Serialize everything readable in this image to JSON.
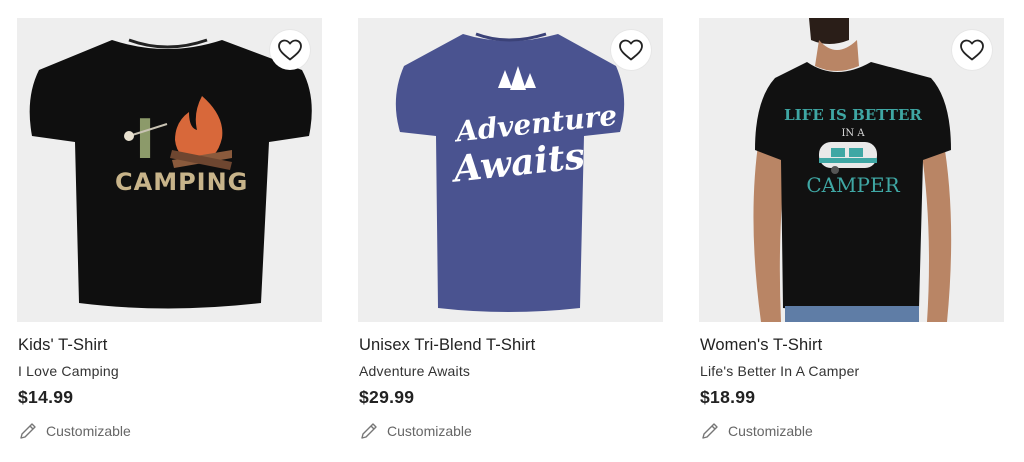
{
  "products": [
    {
      "title": "Kids' T-Shirt",
      "design": "I Love Camping",
      "price": "$14.99",
      "customizable_label": "Customizable",
      "shirt_color": "#0f0f0f",
      "print_text": [
        "I",
        "CAMPING"
      ]
    },
    {
      "title": "Unisex Tri-Blend T-Shirt",
      "design": "Adventure Awaits",
      "price": "$29.99",
      "customizable_label": "Customizable",
      "shirt_color": "#4a5390",
      "print_text": [
        "Adventure",
        "Awaits"
      ]
    },
    {
      "title": "Women's T-Shirt",
      "design": "Life's Better In A Camper",
      "price": "$18.99",
      "customizable_label": "Customizable",
      "shirt_color": "#111111",
      "print_text": [
        "LIFE IS BETTER",
        "IN A",
        "CAMPER"
      ]
    }
  ],
  "icons": {
    "favorite": "heart-outline-icon",
    "customize": "pencil-icon"
  }
}
